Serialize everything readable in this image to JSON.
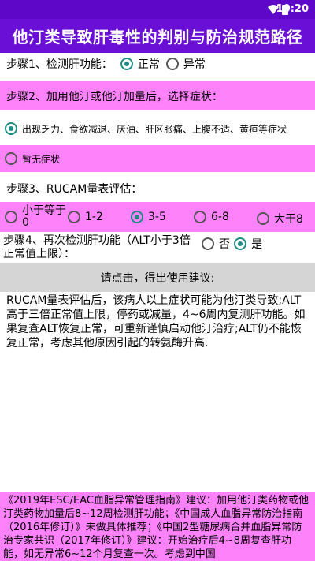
{
  "statusbar": {
    "time": "10:20"
  },
  "appbar": {
    "title": "他汀类导致肝毒性的判别与防治规范路径"
  },
  "step1": {
    "label": "步骤1、检测肝功能：",
    "options": [
      "正常",
      "异常"
    ],
    "selected_index": 0
  },
  "step2": {
    "label": "步骤2、加用他汀或他汀加量后，选择症状：",
    "options": [
      "出现乏力、食欲减退、厌油、肝区胀痛、上腹不适、黄疸等症状",
      "暂无症状"
    ],
    "selected_index": 0
  },
  "step3": {
    "label": "步骤3、RUCAM量表评估：",
    "options": [
      "小于等于0",
      "1-2",
      "3-5",
      "6-8",
      "大于8"
    ],
    "selected_index": 2
  },
  "step4": {
    "label_line1": "步骤4、再次检测肝功能（ALT小于3倍",
    "label_line2": "正常值上限）：",
    "options": [
      "否",
      "是"
    ],
    "selected_index": 1
  },
  "action_button": {
    "label": "请点击，得出使用建议:"
  },
  "result_text": "RUCAM量表评估后，该病人以上症状可能为他汀类导致;ALT高于三倍正常值上限，停药或减量，4~6周内复测肝功能。如果复查ALT恢复正常，可重新谨慎启动他汀治疗;ALT仍不能恢复正常，考虑其他原因引起的转氨酶升高.",
  "footer_text": "《2019年ESC/EAC血脂异常管理指南》建议：加用他汀类药物或他汀类药物加量后8~12周检测肝功能；《中国成人血脂异常防治指南（2016年修订）》未做具体推荐；《中国2型糖尿病合并血脂异常防治专家共识（2017年修订）》建议：开始治疗后4~8周复查肝功能，如无异常6~12个月复查一次。考虑到中国"
}
